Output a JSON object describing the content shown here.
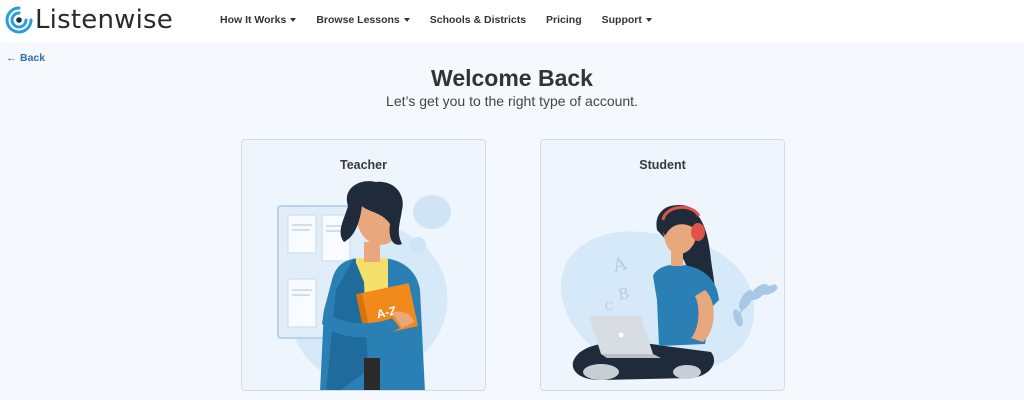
{
  "brand": {
    "name": "Listenwise"
  },
  "nav": [
    {
      "label": "How It Works",
      "dropdown": true
    },
    {
      "label": "Browse Lessons",
      "dropdown": true
    },
    {
      "label": "Schools & Districts",
      "dropdown": false
    },
    {
      "label": "Pricing",
      "dropdown": false
    },
    {
      "label": "Support",
      "dropdown": true
    }
  ],
  "back": {
    "label": "Back"
  },
  "heading": {
    "title": "Welcome Back",
    "subtitle": "Let’s get you to the right type of account."
  },
  "cards": {
    "teacher": {
      "label": "Teacher",
      "book_text": "A-Z"
    },
    "student": {
      "label": "Student",
      "letters": [
        "A",
        "B",
        "C"
      ]
    }
  },
  "colors": {
    "accent": "#2f6fab",
    "background": "#f5f8fc",
    "card": "#eef5fd",
    "book": "#f28a1b"
  },
  "icons": {
    "logo": "listenwise-logo-icon",
    "back": "left-arrow-icon",
    "caret": "chevron-down-icon"
  }
}
